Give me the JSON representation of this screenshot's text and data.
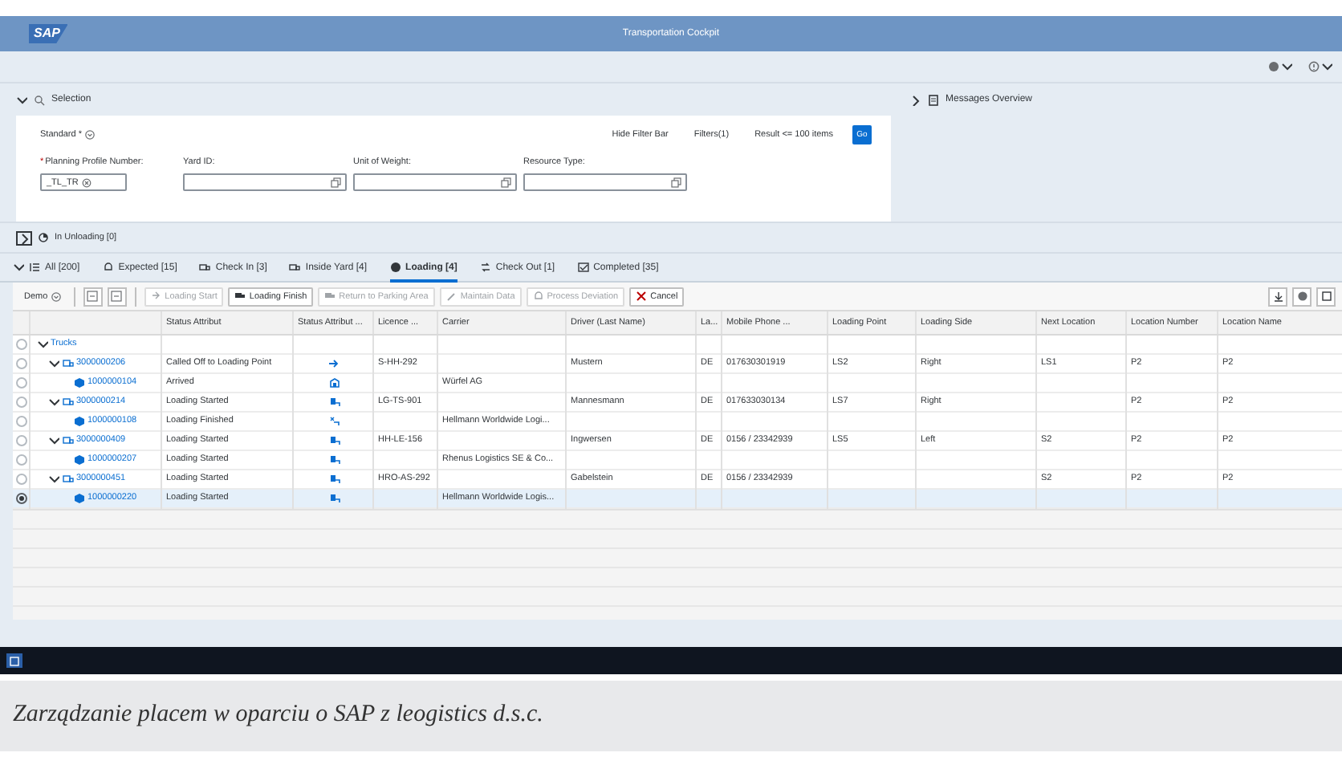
{
  "app": {
    "logo": "SAP",
    "title": "Transportation Cockpit"
  },
  "selection": {
    "label": "Selection",
    "expanded": true,
    "variant": "Standard *",
    "hide_filter_bar": "Hide Filter Bar",
    "filters": "Filters(1)",
    "result": "Result <= 100 items",
    "go": "Go",
    "fields": [
      {
        "required_mark": "*",
        "label": "Planning Profile Number:",
        "value": "_TL_TR"
      },
      {
        "label": "Yard ID:"
      },
      {
        "label": "Unit of Weight:"
      },
      {
        "label": "Resource Type:"
      }
    ]
  },
  "messages": {
    "label": "Messages Overview",
    "expanded": false
  },
  "section": {
    "label": "In Unloading [0]",
    "expanded": false
  },
  "tabs": [
    {
      "label": "All [200]",
      "selected": false
    },
    {
      "label": "Expected [15]",
      "selected": false
    },
    {
      "label": "Check In [3]",
      "selected": false
    },
    {
      "label": "Inside Yard [4]",
      "selected": false
    },
    {
      "label": "Loading [4]",
      "selected": true
    },
    {
      "label": "Check Out [1]",
      "selected": false
    },
    {
      "label": "Completed [35]",
      "selected": false
    }
  ],
  "toolbar": {
    "variant": "Demo",
    "actions": [
      {
        "label": "Loading Start",
        "disabled": true
      },
      {
        "label": "Loading Finish",
        "disabled": false
      },
      {
        "label": "Return to Parking Area",
        "disabled": true
      },
      {
        "label": "Maintain Data",
        "disabled": true
      },
      {
        "label": "Process Deviation",
        "disabled": true
      },
      {
        "label": "Cancel",
        "disabled": false
      }
    ]
  },
  "table": {
    "columns": [
      "Status Attribut",
      "Status Attribut ...",
      "Licence ...",
      "Carrier",
      "Driver (Last Name)",
      "La...",
      "Mobile Phone ...",
      "Loading Point",
      "Loading Side",
      "Next Location",
      "Location Number",
      "Location Name"
    ],
    "rows": [
      {
        "label": "Trucks",
        "selected": false,
        "expanded": true,
        "children": [
          {
            "label": "3000000206",
            "selected": false,
            "expanded": true,
            "status": "Called Off to Loading Point",
            "kind": "arrow",
            "cells": [
              "S-HH-292",
              null,
              "Mustern",
              "DE",
              "017630301919",
              "LS2",
              "Right",
              "LS1",
              "P2",
              "P2"
            ],
            "children": [
              {
                "label": "1000000104",
                "selected": false,
                "status": "Arrived",
                "kind": "arrived",
                "cells": [
                  null,
                  "Würfel AG",
                  null,
                  null,
                  null,
                  null,
                  null,
                  null,
                  null,
                  null
                ]
              }
            ]
          },
          {
            "label": "3000000214",
            "selected": false,
            "expanded": true,
            "status": "Loading Started",
            "kind": "loading",
            "cells": [
              "LG-TS-901",
              null,
              "Mannesmann",
              "DE",
              "017633030134",
              "LS7",
              "Right",
              null,
              "P2",
              "P2"
            ],
            "children": [
              {
                "label": "1000000108",
                "selected": false,
                "status": "Loading Finished",
                "kind": "finished",
                "cells": [
                  null,
                  "Hellmann Worldwide Logi...",
                  null,
                  null,
                  null,
                  null,
                  null,
                  null,
                  null,
                  null
                ]
              }
            ]
          },
          {
            "label": "3000000409",
            "selected": false,
            "expanded": true,
            "status": "Loading Started",
            "kind": "loading",
            "cells": [
              "HH-LE-156",
              null,
              "Ingwersen",
              "DE",
              "0156 / 23342939",
              "LS5",
              "Left",
              "S2",
              "P2",
              "P2"
            ],
            "children": [
              {
                "label": "1000000207",
                "selected": false,
                "status": "Loading Started",
                "kind": "loading",
                "cells": [
                  null,
                  "Rhenus Logistics SE & Co...",
                  null,
                  null,
                  null,
                  null,
                  null,
                  null,
                  null,
                  null
                ]
              }
            ]
          },
          {
            "label": "3000000451",
            "selected": false,
            "expanded": true,
            "status": "Loading Started",
            "kind": "loading",
            "cells": [
              "HRO-AS-292",
              null,
              "Gabelstein",
              "DE",
              "0156 / 23342939",
              null,
              null,
              "S2",
              "P2",
              "P2"
            ],
            "children": [
              {
                "label": "1000000220",
                "selected": true,
                "status": "Loading Started",
                "kind": "loading",
                "cells": [
                  null,
                  "Hellmann Worldwide Logis...",
                  null,
                  null,
                  null,
                  null,
                  null,
                  null,
                  null,
                  null
                ]
              }
            ]
          }
        ]
      }
    ]
  },
  "caption": "Zarządzanie placem w oparciu o SAP z leogistics d.s.c."
}
